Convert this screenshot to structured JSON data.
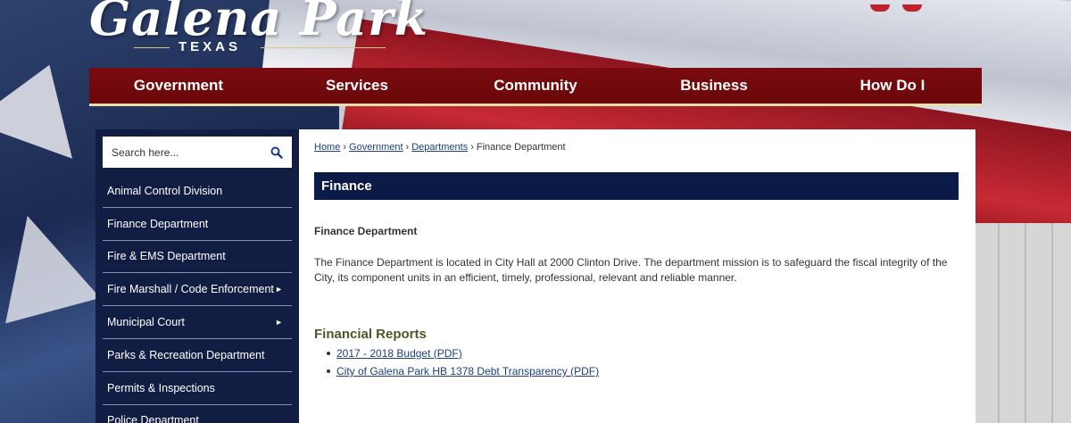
{
  "site": {
    "name": "Galena Park",
    "subtitle": "TEXAS"
  },
  "nav": [
    "Government",
    "Services",
    "Community",
    "Business",
    "How Do I"
  ],
  "search": {
    "placeholder": "Search here..."
  },
  "sidebar": {
    "items": [
      {
        "label": "Animal Control Division",
        "has_submenu": false
      },
      {
        "label": "Finance Department",
        "has_submenu": false
      },
      {
        "label": "Fire & EMS Department",
        "has_submenu": false
      },
      {
        "label": "Fire Marshall / Code Enforcement",
        "has_submenu": true
      },
      {
        "label": "Municipal Court",
        "has_submenu": true
      },
      {
        "label": "Parks & Recreation Department",
        "has_submenu": false
      },
      {
        "label": "Permits & Inspections",
        "has_submenu": false
      },
      {
        "label": "Police Department",
        "has_submenu": false
      }
    ],
    "arrow_glyph": "►"
  },
  "breadcrumb": [
    "Home",
    "Government",
    "Departments",
    "Finance Department"
  ],
  "page": {
    "title": "Finance",
    "section_heading": "Finance Department",
    "paragraph": "The Finance Department is located in City Hall at 2000 Clinton Drive. The department mission is to safeguard the fiscal integrity of the City, its component units in an efficient, timely, professional, relevant and reliable manner.",
    "reports_heading": "Financial Reports",
    "reports": [
      "2017 - 2018 Budget (PDF)",
      "City of Galena Park HB 1378 Debt Transparency (PDF)"
    ]
  },
  "colors": {
    "nav_bg": "#6e0a0d",
    "sidebar_bg": "#121d44",
    "title_bar": "#0c1a47",
    "reports_heading": "#4a5a23",
    "link": "#1c3f7a"
  }
}
